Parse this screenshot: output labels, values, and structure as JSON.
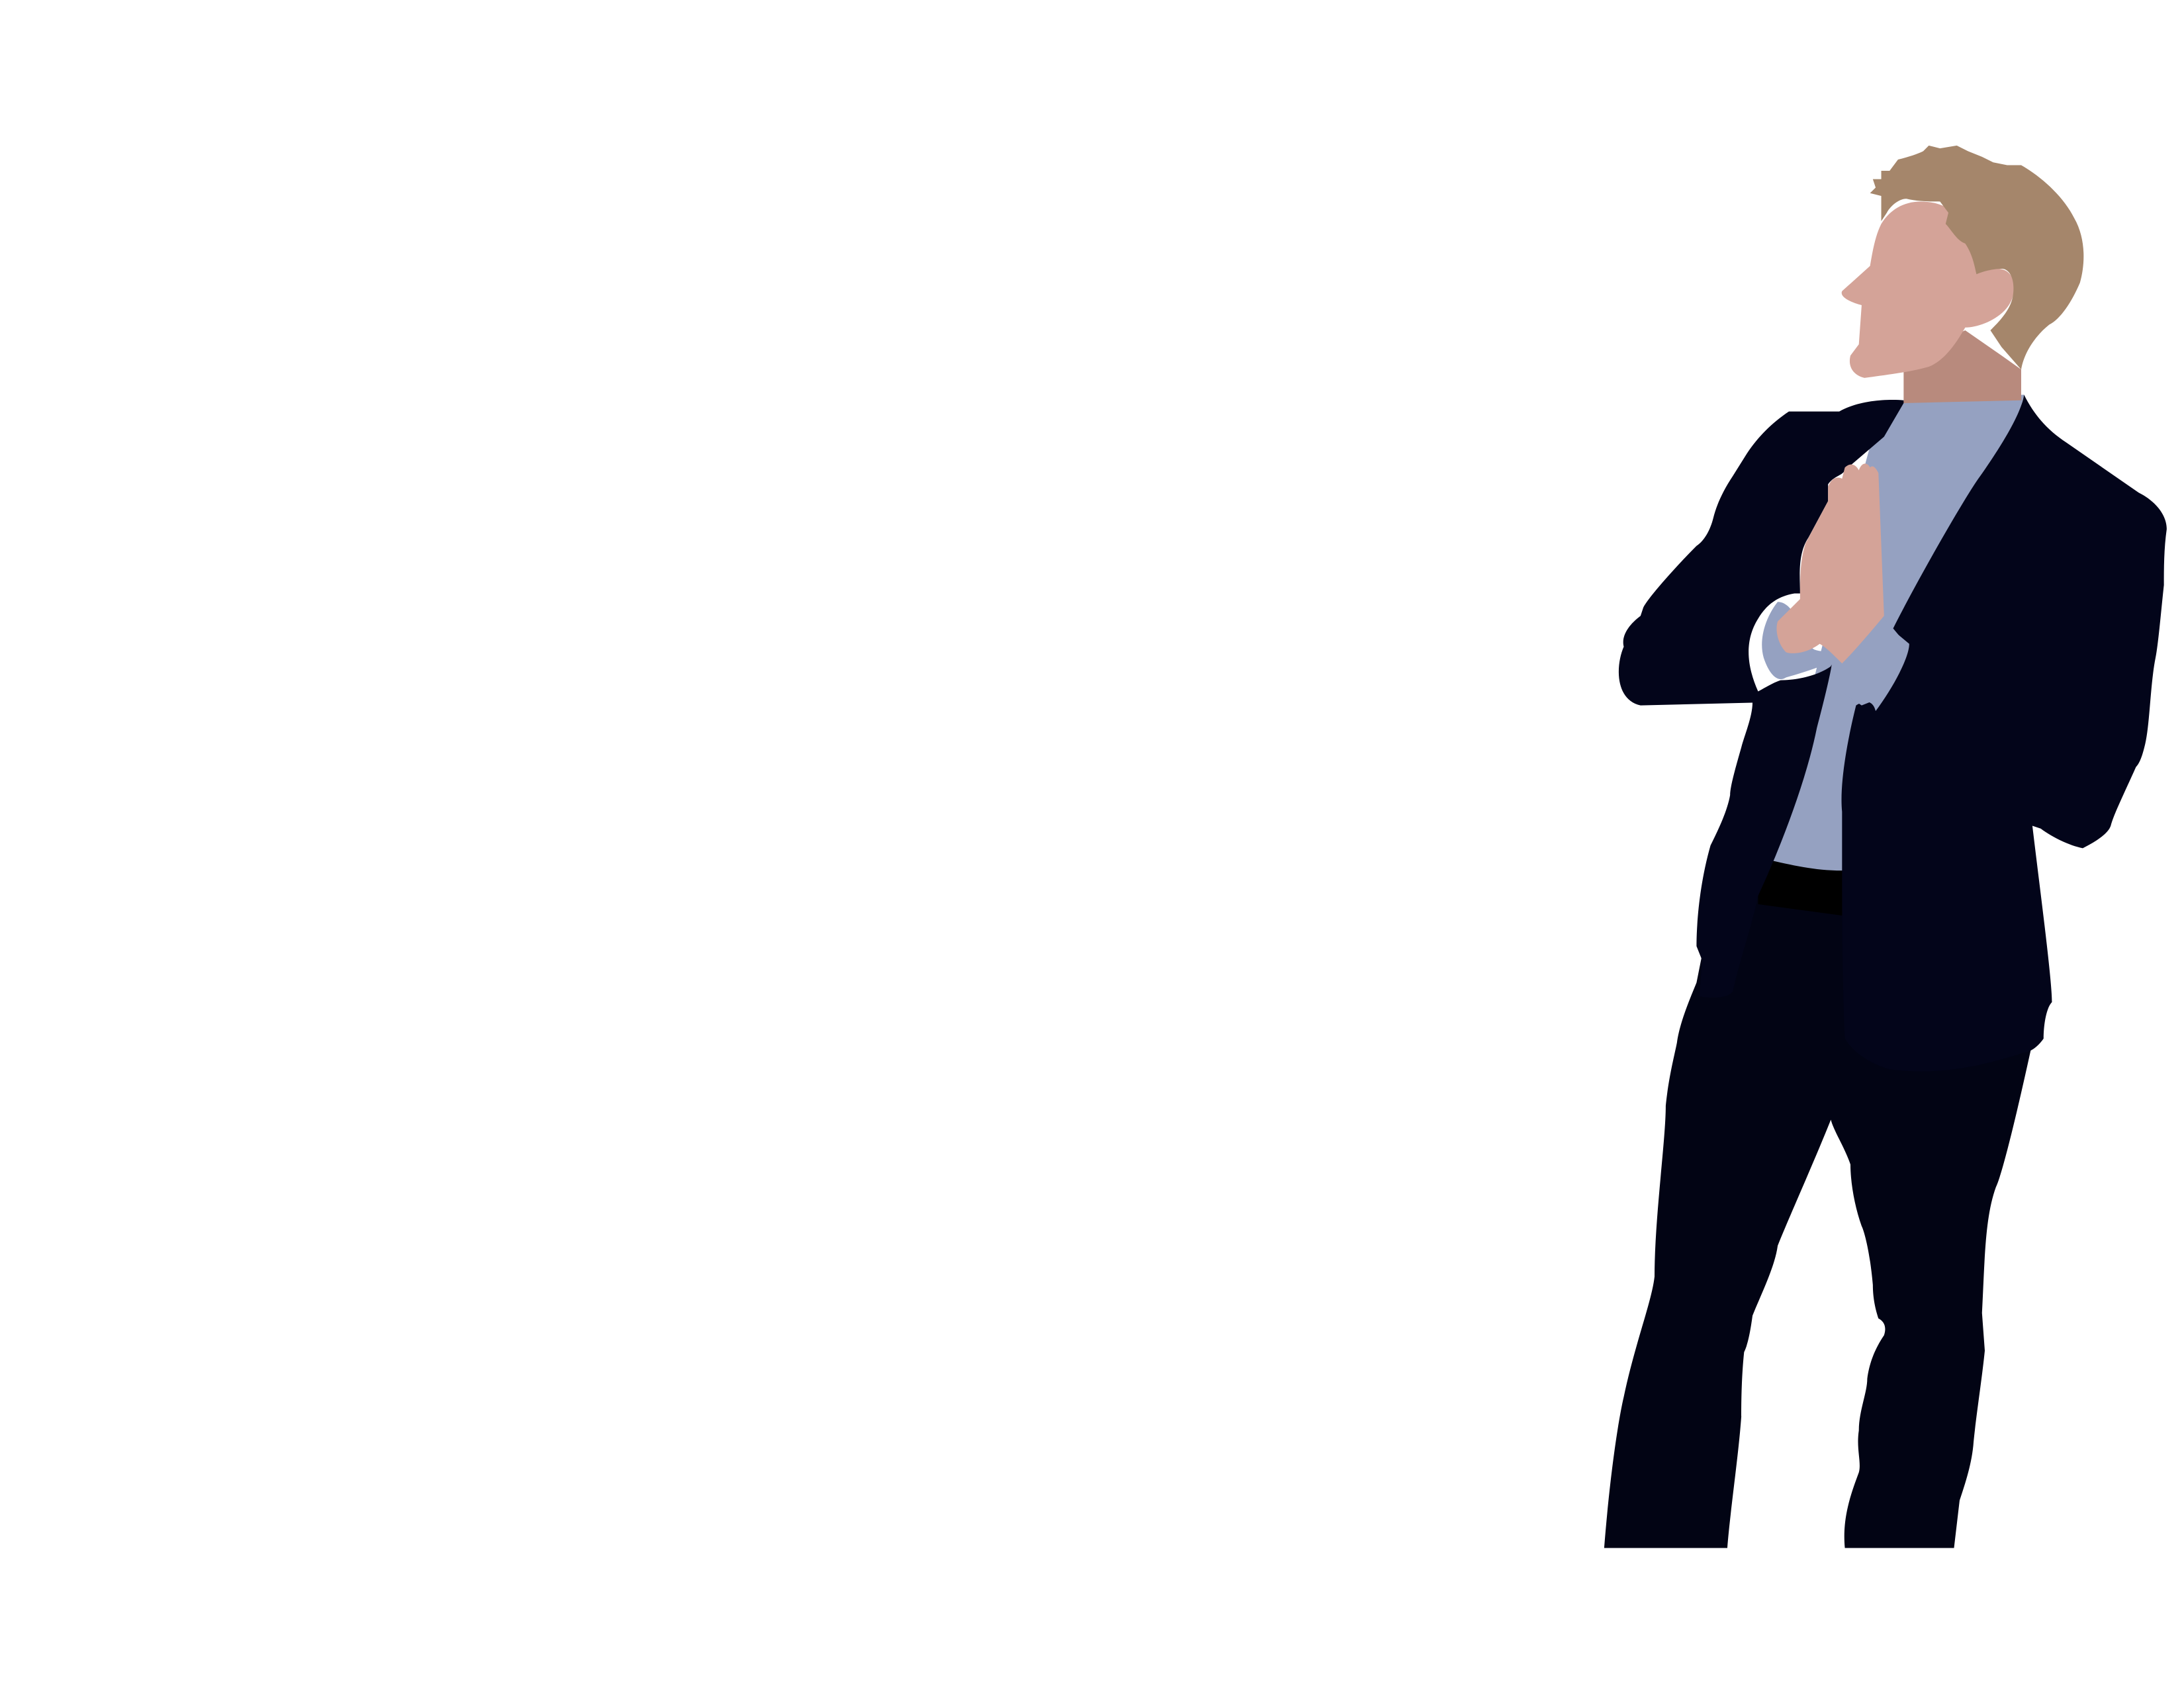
{
  "scene": {
    "subject": "standing-man-illustration",
    "background_color": "#ffffff"
  },
  "palette": {
    "hair": "#A5866B",
    "skin": "#D4A398",
    "neck_shadow": "#B88A7D",
    "shirt": "#95A1C1",
    "jacket": "#03051A",
    "trousers": "#020414",
    "belt": "#000000"
  }
}
